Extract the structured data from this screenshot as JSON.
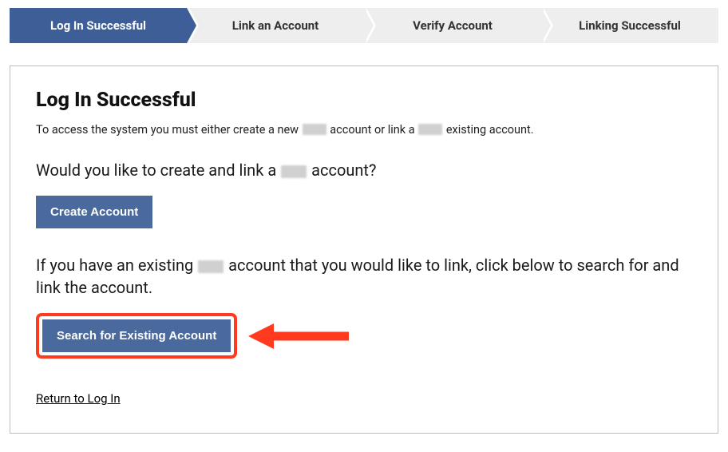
{
  "stepper": {
    "steps": [
      {
        "label": "Log In Successful",
        "active": true
      },
      {
        "label": "Link an Account",
        "active": false
      },
      {
        "label": "Verify Account",
        "active": false
      },
      {
        "label": "Linking Successful",
        "active": false
      }
    ]
  },
  "panel": {
    "heading": "Log In Successful",
    "intro_before": "To access the system you must either create a new ",
    "intro_mid": " account or link a ",
    "intro_after": " existing account.",
    "q1_before": "Would you like to create and link a ",
    "q1_after": " account?",
    "create_label": "Create Account",
    "q2_before": "If you have an existing ",
    "q2_after": " account that you would like to link, click below to search for and link the account.",
    "search_label": "Search for Existing Account",
    "return_label": "Return to Log In"
  }
}
